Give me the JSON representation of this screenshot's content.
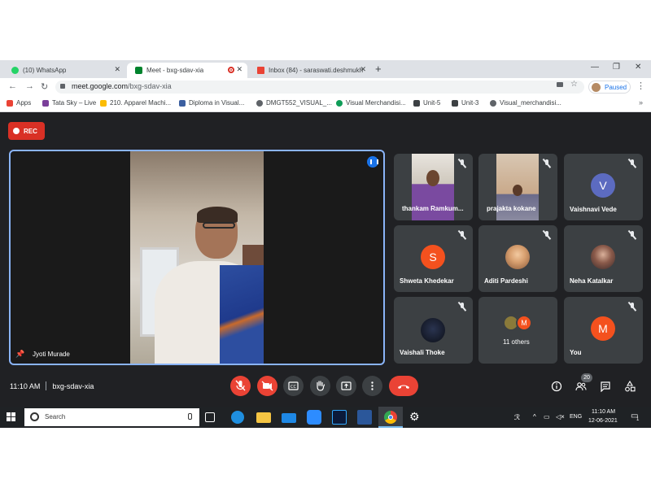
{
  "browser": {
    "tabs": [
      {
        "title": "(10) WhatsApp",
        "color": "#25d366"
      },
      {
        "title": "Meet - bxg-sdav-xia",
        "color": "#00832d",
        "recording": true
      },
      {
        "title": "Inbox (84) - saraswati.deshmukh",
        "color": "#ea4335"
      }
    ],
    "url_domain": "meet.google.com",
    "url_path": "/bxg-sdav-xia",
    "profile_status": "Paused",
    "bookmarks": [
      {
        "label": "Apps",
        "color": "#ea4335"
      },
      {
        "label": "Tata Sky – Live",
        "color": "#7a3f9a"
      },
      {
        "label": "210. Apparel Machi...",
        "color": "#fbbc04"
      },
      {
        "label": "Diploma in Visual...",
        "color": "#3b5fa0"
      },
      {
        "label": "DMGT552_VISUAL_...",
        "color": "#5f6368"
      },
      {
        "label": "Visual Merchandisi...",
        "color": "#0f9d58"
      },
      {
        "label": "Unit-5",
        "color": "#3c4043"
      },
      {
        "label": "Unit-3",
        "color": "#3c4043"
      },
      {
        "label": "Visual_merchandisi...",
        "color": "#5f6368"
      }
    ],
    "bookmarks_more": "»"
  },
  "meet": {
    "rec_label": "REC",
    "main_speaker": "Jyoti Murade",
    "participants": [
      {
        "name": "thankam Ramkum...",
        "type": "video",
        "video_color": "#7a4aa0"
      },
      {
        "name": "prajakta kokane",
        "type": "video",
        "video_color": "#c9a98a"
      },
      {
        "name": "Vaishnavi Vede",
        "type": "avatar",
        "initial": "V",
        "color": "#5c6bc0"
      },
      {
        "name": "Shweta Khedekar",
        "type": "avatar",
        "initial": "S",
        "color": "#f4511e"
      },
      {
        "name": "Aditi Pardeshi",
        "type": "photo",
        "color": "#d8a070"
      },
      {
        "name": "Neha Katalkar",
        "type": "photo",
        "color": "#5a3d3a"
      },
      {
        "name": "Vaishali Thoke",
        "type": "photo",
        "color": "#1a1f2e"
      },
      {
        "name": "11 others",
        "type": "others",
        "initial": "M",
        "color": "#f4511e"
      },
      {
        "name": "You",
        "type": "avatar",
        "initial": "M",
        "color": "#f4511e"
      }
    ],
    "time": "11:10 AM",
    "meeting_code": "bxg-sdav-xia",
    "participant_count": "20"
  },
  "taskbar": {
    "search_placeholder": "Search",
    "language": "ENG",
    "clock_time": "11:10 AM",
    "clock_date": "12-06-2021",
    "notification_count": "1"
  }
}
